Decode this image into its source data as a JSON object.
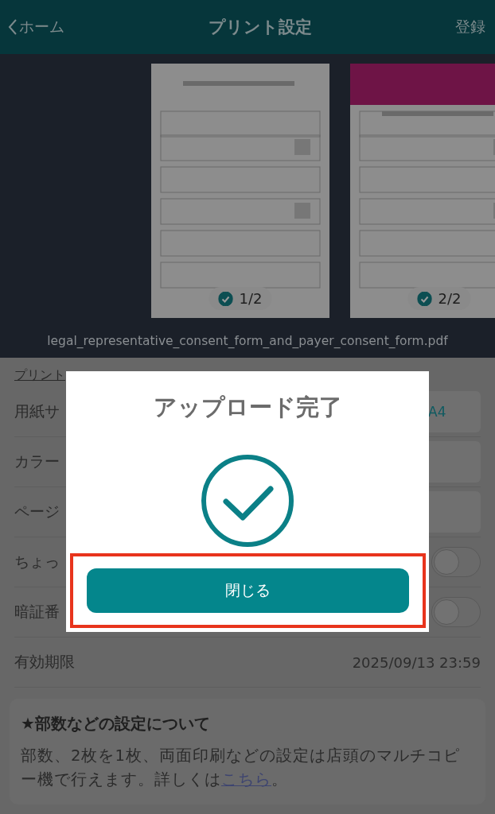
{
  "header": {
    "back": "ホーム",
    "title": "プリント設定",
    "action": "登録"
  },
  "pages": [
    {
      "kind": "plain",
      "label": "1/2",
      "checked": true
    },
    {
      "kind": "banner",
      "label": "2/2",
      "checked": true
    }
  ],
  "file_name": "legal_representative_consent_form_and_payer_consent_form.pdf",
  "section_title": "プリント",
  "settings": [
    {
      "kind": "select",
      "label": "用紙サ",
      "value": "A4"
    },
    {
      "kind": "select",
      "label": "カラー"
    },
    {
      "kind": "select",
      "label": "ページ"
    },
    {
      "kind": "toggle",
      "label": "ちょっ",
      "on": false
    },
    {
      "kind": "toggle",
      "label": "暗証番",
      "on": false
    },
    {
      "kind": "text",
      "label": "有効期限",
      "value": "2025/09/13 23:59"
    }
  ],
  "info": {
    "title": "★部数などの設定について",
    "text": "部数、2枚を1枚、両面印刷などの設定は店頭のマルチコピー機で行えます。詳しくは",
    "link": "こちら",
    "end": "。"
  },
  "dialog": {
    "title": "アップロード完了",
    "button": "閉じる",
    "highlighted": true
  }
}
